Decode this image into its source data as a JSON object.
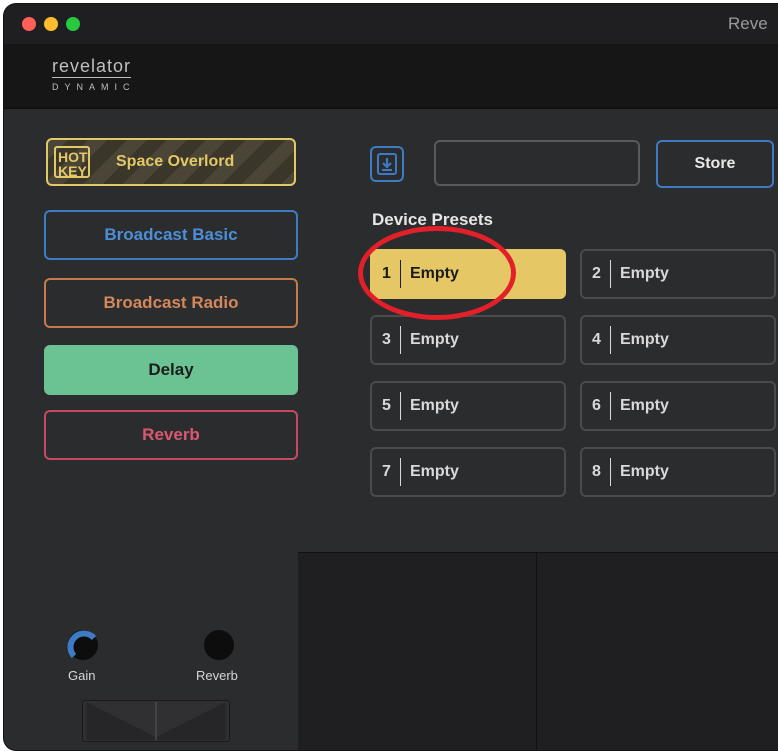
{
  "window": {
    "title": "Reve"
  },
  "header": {
    "logo_main": "revelator",
    "logo_sub": "DYNAMIC"
  },
  "hotkey": {
    "tag": "HOT KEY",
    "preset_name": "Space Overlord",
    "color": "#e2c866"
  },
  "sidebar_presets": [
    {
      "label": "Broadcast Basic",
      "color": "#3f7bc4"
    },
    {
      "label": "Broadcast Radio",
      "color": "#c67a4a"
    },
    {
      "label": "Delay",
      "color": "#6bc393"
    },
    {
      "label": "Reverb",
      "color": "#c44a62"
    }
  ],
  "store_bar": {
    "save_icon": "download-icon",
    "name_value": "",
    "store_label": "Store"
  },
  "device_presets": {
    "title": "Device Presets",
    "slots": [
      {
        "num": "1",
        "label": "Empty",
        "selected": true
      },
      {
        "num": "2",
        "label": "Empty"
      },
      {
        "num": "3",
        "label": "Empty"
      },
      {
        "num": "4",
        "label": "Empty"
      },
      {
        "num": "5",
        "label": "Empty"
      },
      {
        "num": "6",
        "label": "Empty"
      },
      {
        "num": "7",
        "label": "Empty"
      },
      {
        "num": "8",
        "label": "Empty"
      }
    ]
  },
  "knobs": [
    {
      "label": "Gain",
      "color": "#3f7bc4"
    },
    {
      "label": "Reverb",
      "color": "#ffffff"
    }
  ],
  "colors": {
    "accent_yellow": "#e5c765",
    "highlight_red": "#e1202a",
    "background": "#2b2c2e"
  }
}
